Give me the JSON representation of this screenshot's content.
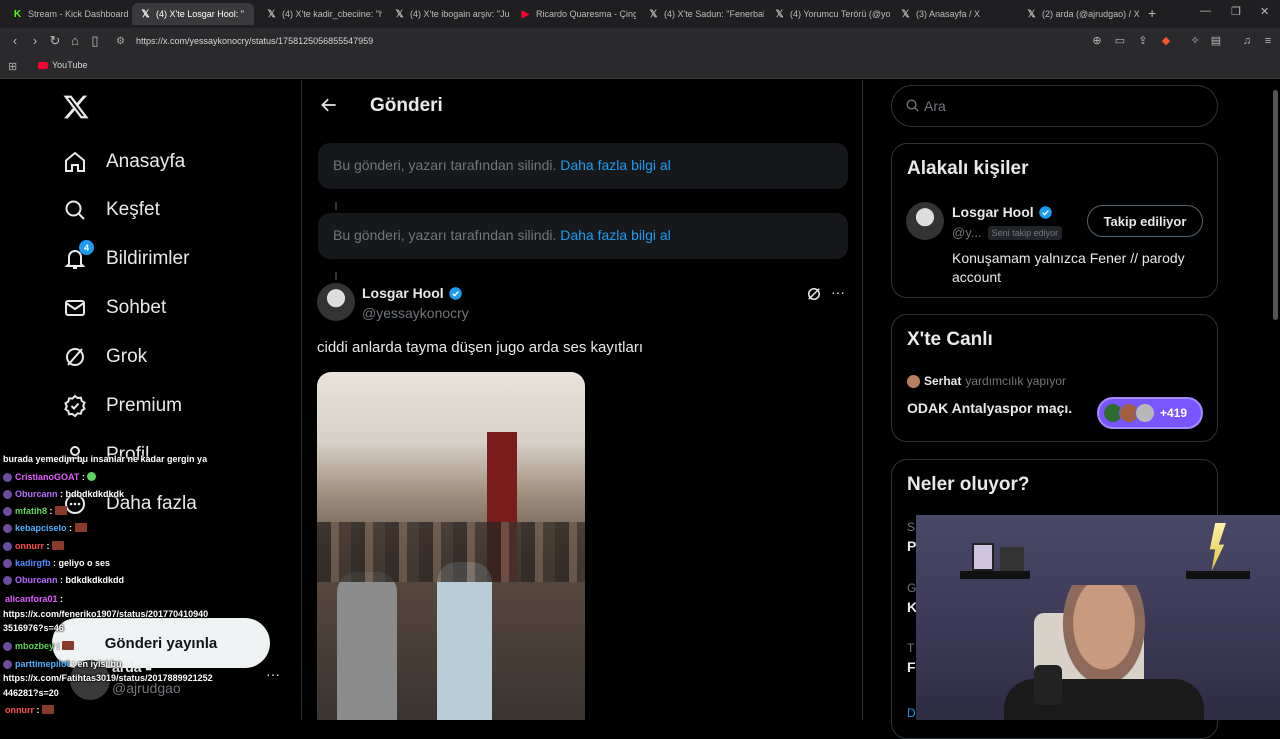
{
  "browser": {
    "tabs": [
      {
        "label": "Stream - Kick Dashboard",
        "icon": "K",
        "color": "#53fc18",
        "active": false
      },
      {
        "label": "(4) X'te Losgar Hool: \"",
        "icon": "X",
        "color": "#ffffff",
        "active": true
      },
      {
        "label": "(4) X'te kadir_cbeciine: \"ht",
        "icon": "X",
        "color": "#ffffff",
        "active": false
      },
      {
        "label": "(4) X'te ibogain arşiv: \"Jug",
        "icon": "X",
        "color": "#ffffff",
        "active": false
      },
      {
        "label": "Ricardo Quaresma - Çinge",
        "icon": "▶",
        "color": "#ff0033",
        "active": false
      },
      {
        "label": "(4) X'te Sadun: \"Fenerbahç",
        "icon": "X",
        "color": "#ffffff",
        "active": false
      },
      {
        "label": "(4) Yorumcu Terörü (@yor",
        "icon": "X",
        "color": "#ffffff",
        "active": false
      },
      {
        "label": "(3) Anasayfa / X",
        "icon": "X",
        "color": "#ffffff",
        "active": false
      },
      {
        "label": "(2) arda (@ajrudgao) / X",
        "icon": "X",
        "color": "#ffffff",
        "active": false
      }
    ],
    "url": "https://x.com/yessaykonocry/status/1758125056855547959",
    "bookmark_label": "YouTube"
  },
  "nav": {
    "items": [
      {
        "label": "Anasayfa",
        "icon": "home-icon"
      },
      {
        "label": "Keşfet",
        "icon": "search-icon"
      },
      {
        "label": "Bildirimler",
        "icon": "bell-icon",
        "badge": "4"
      },
      {
        "label": "Sohbet",
        "icon": "mail-icon"
      },
      {
        "label": "Grok",
        "icon": "grok-icon"
      },
      {
        "label": "Premium",
        "icon": "premium-icon"
      },
      {
        "label": "Profil",
        "icon": "profile-icon"
      },
      {
        "label": "Daha fazla",
        "icon": "more-icon"
      }
    ],
    "post_button": "Gönderi yayınla",
    "account_name": "arda",
    "account_handle": "@ajrudgao"
  },
  "main": {
    "header": "Gönderi",
    "deleted_1": "Bu gönderi, yazarı tarafından silindi.",
    "deleted_2": "Bu gönderi, yazarı tarafından silindi.",
    "learn_more": "Daha fazla bilgi al",
    "tweet": {
      "author": "Losgar Hool",
      "handle": "@yessaykonocry",
      "text": "ciddi anlarda tayma düşen jugo arda ses kayıtları"
    }
  },
  "right": {
    "search_placeholder": "Ara",
    "related_title": "Alakalı kişiler",
    "related_person": {
      "name": "Losgar Hool",
      "handle": "@y...",
      "follows_you": "Seni takip ediyor",
      "follow_button": "Takip ediliyor",
      "bio": "Konuşamam yalnızca Fener // parody account"
    },
    "live_title": "X'te Canlı",
    "live": {
      "host": "Serhat",
      "host_status": "yardımcılık yapıyor",
      "title": "ODAK Antalyaspor maçı.",
      "count": "+419"
    },
    "trends_title": "Neler oluyor?",
    "trends_partial": [
      "S",
      "P",
      "G",
      "K",
      "T",
      "Fe",
      "D"
    ]
  },
  "chat": [
    {
      "user": "",
      "msg": "burada yemedim bu insanlar ne kadar gergin ya",
      "color": "#ffffff"
    },
    {
      "user": "CristianoGOAT",
      "msg": ":",
      "color": "#e05cff",
      "emote": true
    },
    {
      "user": "Oburcann",
      "msg": ": bdbdkdkdkdk",
      "color": "#b56cff"
    },
    {
      "user": "mfatih8",
      "msg": ":",
      "color": "#5fd35f",
      "emote": true
    },
    {
      "user": "kebapciselo",
      "msg": ":",
      "color": "#4fb0ff",
      "emote": true
    },
    {
      "user": "onnurr",
      "msg": ":",
      "color": "#ff4f4f",
      "emote": true
    },
    {
      "user": "kadirgfb",
      "msg": ": geliyo o ses",
      "color": "#4f8cff"
    },
    {
      "user": "Oburcann",
      "msg": ": bdkdkdkdkdd",
      "color": "#b56cff"
    },
    {
      "user": "alicanfora01",
      "msg": ":",
      "color": "#e05cff"
    },
    {
      "user": "",
      "msg": "https://x.com/feneriko1907/status/201770410940",
      "color": "#ffffff"
    },
    {
      "user": "",
      "msg": "3516976?s=46",
      "color": "#ffffff"
    },
    {
      "user": "mbozbey",
      "msg": ":",
      "color": "#5fd35f",
      "emote": true
    },
    {
      "user": "parttimepilot",
      "msg": ": en iyisi bu",
      "color": "#4fb0ff"
    },
    {
      "user": "",
      "msg": "https://x.com/Fatihtas3019/status/2017889921252",
      "color": "#ffffff"
    },
    {
      "user": "",
      "msg": "446281?s=20",
      "color": "#ffffff"
    },
    {
      "user": "onnurr",
      "msg": ":",
      "color": "#ff4f4f",
      "emote": true
    }
  ]
}
